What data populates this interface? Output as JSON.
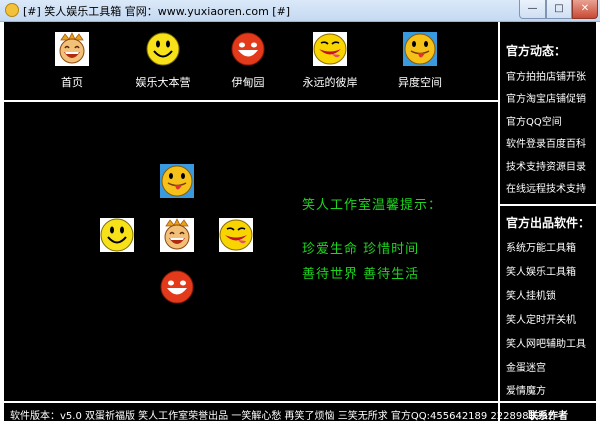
{
  "window": {
    "title": "[#] 笑人娱乐工具箱    官网：www.yuxiaoren.com [#]",
    "controls": [
      "minimize",
      "maximize",
      "close"
    ]
  },
  "nav": [
    {
      "label": "首页",
      "icon": "laughing-face-icon"
    },
    {
      "label": "娱乐大本营",
      "icon": "smiley-face-icon"
    },
    {
      "label": "伊甸园",
      "icon": "red-smiley-icon"
    },
    {
      "label": "永远的彼岸",
      "icon": "grinning-face-icon"
    },
    {
      "label": "异度空间",
      "icon": "tongue-out-face-icon"
    }
  ],
  "right_panel": {
    "news_title": "官方动态：",
    "news": [
      "官方拍拍店铺开张",
      "官方淘宝店铺促销",
      "官方QQ空间",
      "软件登录百度百科",
      "技术支持资源目录",
      "在线远程技术支持"
    ],
    "software_title": "官方出品软件：",
    "software": [
      "系统万能工具箱",
      "笑人娱乐工具箱",
      "笑人挂机锁",
      "笑人定时开关机",
      "笑人网吧辅助工具",
      "金蛋迷宫",
      "爱情魔方"
    ]
  },
  "tips": {
    "title": "笑人工作室温馨提示：",
    "line1": "珍爱生命    珍惜时间",
    "line2": "善待世界    善待生活"
  },
  "status": {
    "text": "软件版本：v5.0 双蛋祈福版    笑人工作室荣誉出品    一笑解心愁 再笑了烦恼 三笑无所求    官方QQ:455642189 2228983232",
    "contact": "联系作者"
  },
  "colors": {
    "background": "#000000",
    "text": "#ffffff",
    "tip_green": "#1fd41f"
  }
}
